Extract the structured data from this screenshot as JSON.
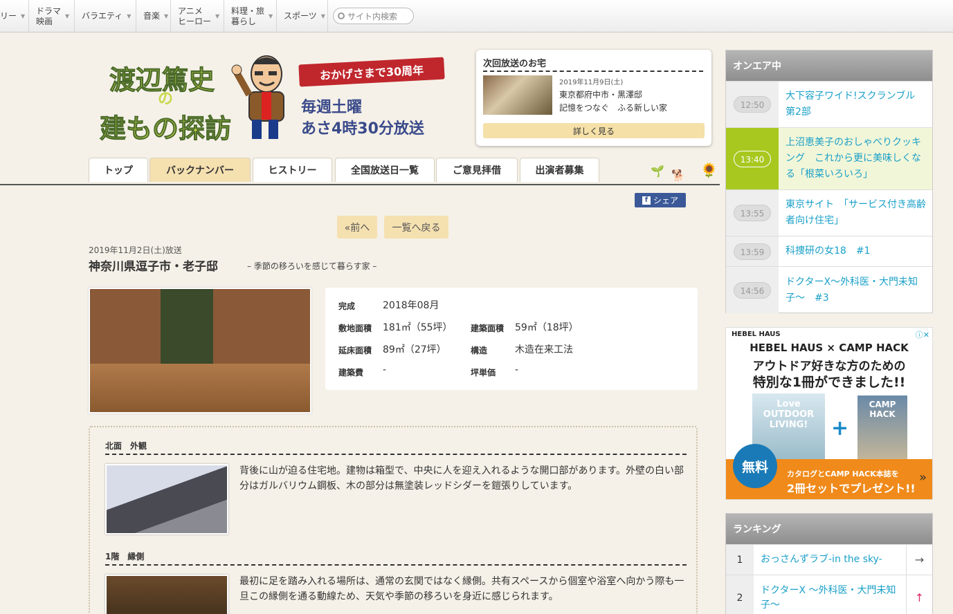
{
  "topnav": {
    "items": [
      {
        "label": "リー"
      },
      {
        "label": "ドラマ\n映画"
      },
      {
        "label": "バラエティ"
      },
      {
        "label": "音楽"
      },
      {
        "label": "アニメ\nヒーロー"
      },
      {
        "label": "料理・旅\n暮らし"
      },
      {
        "label": "スポーツ"
      }
    ],
    "search_placeholder": "サイト内検索"
  },
  "logo": {
    "title_line1": "渡辺篤史",
    "title_no": "の",
    "title_line2": "建もの探訪",
    "banner": "おかげさまで30周年",
    "schedule_line1": "毎週土曜",
    "schedule_line2": "あさ4時30分放送"
  },
  "next_broadcast": {
    "heading": "次回放送のお宅",
    "date": "2019年11月9日(土)",
    "location": "東京都府中市・黒澤邸",
    "description": "記憶をつなぐ　ふる新しい家",
    "button": "詳しく見る"
  },
  "menu": {
    "tabs": [
      "トップ",
      "バックナンバー",
      "ヒストリー",
      "全国放送日一覧",
      "ご意見拝借",
      "出演者募集"
    ]
  },
  "share": {
    "label": "シェア",
    "icon": "facebook-icon"
  },
  "pager": {
    "prev": "«前へ",
    "back": "一覧へ戻る"
  },
  "episode": {
    "date": "2019年11月2日(土)放送",
    "title": "神奈川県逗子市・老子邸",
    "subtitle": "– 季節の移ろいを感じて暮らす家 –"
  },
  "specs": {
    "complete_label": "完成",
    "complete_value": "2018年08月",
    "site_label": "敷地面積",
    "site_value": "181㎡（55坪）",
    "building_label": "建築面積",
    "building_value": "59㎡（18坪）",
    "floor_label": "延床面積",
    "floor_value": "89㎡（27坪）",
    "structure_label": "構造",
    "structure_value": "木造在来工法",
    "cost_label": "建築費",
    "cost_value": "-",
    "unit_label": "坪単価",
    "unit_value": "-"
  },
  "photos": [
    {
      "heading": "北面　外観",
      "text": "背後に山が迫る住宅地。建物は箱型で、中央に人を迎え入れるような開口部があります。外壁の白い部分はガルバリウム鋼板、木の部分は無塗装レッドシダーを鎧張りしています。"
    },
    {
      "heading": "1階　縁側",
      "text": "最初に足を踏み入れる場所は、通常の玄関ではなく縁側。共有スペースから個室や浴室へ向かう際も一旦この縁側を通る動線ため、天気や季節の移ろいを身近に感じられます。"
    }
  ],
  "onair": {
    "heading": "オンエア中",
    "items": [
      {
        "time": "12:50",
        "title": "大下容子ワイド!スクランブル　第2部"
      },
      {
        "time": "13:40",
        "title": "上沼恵美子のおしゃべりクッキング　これから更に美味しくなる「根菜いろいろ」"
      },
      {
        "time": "13:55",
        "title": "東京サイト　「サービス付き高齢者向け住宅」"
      },
      {
        "time": "13:59",
        "title": "科捜研の女18　#1"
      },
      {
        "time": "14:56",
        "title": "ドクターX～外科医・大門未知子～　#3"
      }
    ]
  },
  "ad": {
    "brand": "HEBEL HAUS",
    "line1": "HEBEL HAUS × CAMP HACK",
    "line2": "アウトドア好きな方のための",
    "line3": "特別な1冊ができました!!",
    "book1": "Love OUTDOOR LIVING!",
    "book2": "CAMP HACK",
    "free": "無料",
    "bottom1": "カタログとCAMP HACK本誌を",
    "bottom2": "2冊セットでプレゼント!!",
    "close_icon": "ad-info-icon"
  },
  "ranking": {
    "heading": "ランキング",
    "items": [
      {
        "rank": "1",
        "title": "おっさんずラブ-in the sky-",
        "trend": "→"
      },
      {
        "rank": "2",
        "title": "ドクターX ～外科医・大門未知子～",
        "trend": "↑"
      }
    ]
  },
  "colors": {
    "accent_green": "#a8c820",
    "link_blue": "#1aa0c8",
    "tab_active": "#f5e0b0",
    "facebook": "#3b5998"
  }
}
